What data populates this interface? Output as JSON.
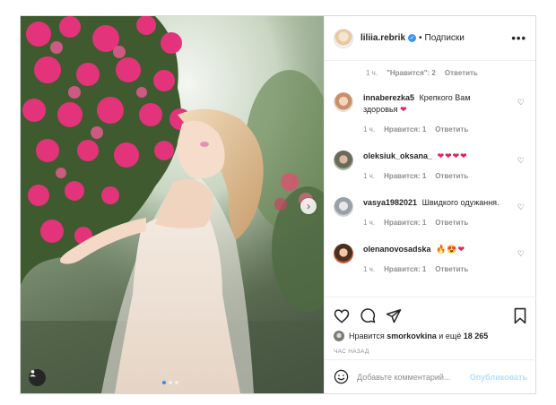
{
  "post": {
    "author": "liliia.rebrik",
    "separator": "•",
    "follow_label": "Подписки",
    "more_label": "•••",
    "verified_mark": "✓"
  },
  "top_meta": {
    "time": "1 ч.",
    "likes": "\"Нравится\": 2",
    "reply": "Ответить"
  },
  "comments": [
    {
      "user": "innaberezka5",
      "text": "Крепкого Вам здоровья",
      "emoji": "❤",
      "time": "1 ч.",
      "likes": "Нравится: 1",
      "reply": "Ответить"
    },
    {
      "user": "oleksiuk_oksana_",
      "text": "",
      "emoji": "❤❤❤❤",
      "time": "1 ч.",
      "likes": "Нравится: 1",
      "reply": "Ответить"
    },
    {
      "user": "vasya1982021",
      "text": "Швидкого одужання.",
      "emoji": "",
      "time": "1 ч.",
      "likes": "Нравится: 1",
      "reply": "Ответить"
    },
    {
      "user": "olenanovosadska",
      "text": "",
      "emoji": "🔥😍❤",
      "time": "1 ч.",
      "likes": "Нравится: 1",
      "reply": "Ответить"
    }
  ],
  "likes": {
    "prefix": "Нравится",
    "user": "smorkovkina",
    "middle": "и ещё",
    "count": "18 265"
  },
  "timestamp": "ЧАС НАЗАД",
  "comment_box": {
    "placeholder": "Добавьте комментарий...",
    "publish_label": "Опубликовать"
  },
  "icons": {
    "like": "heart-icon",
    "comment": "comment-icon",
    "share": "share-icon",
    "save": "bookmark-icon",
    "emoji": "emoji-icon",
    "next": "chevron-right-icon",
    "tag": "user-tag-icon"
  },
  "colors": {
    "accent": "#3897f0",
    "heart": "#e0245e",
    "muted": "#8e8e8e",
    "publish_disabled": "#b2dffc"
  },
  "carousel": {
    "slides": 3,
    "active": 1
  }
}
